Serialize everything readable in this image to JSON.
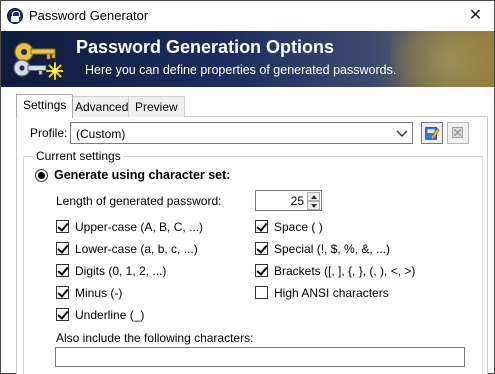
{
  "window": {
    "title": "Password Generator",
    "close_glyph": "✕"
  },
  "banner": {
    "title": "Password Generation Options",
    "subtitle": "Here you can define properties of generated passwords."
  },
  "tabs": [
    {
      "label": "Settings",
      "active": true
    },
    {
      "label": "Advanced",
      "active": false
    },
    {
      "label": "Preview",
      "active": false
    }
  ],
  "profile": {
    "label": "Profile:",
    "value": "(Custom)"
  },
  "group": {
    "title": "Current settings",
    "radio_label": "Generate using character set:",
    "length_label": "Length of generated password:",
    "length_value": "25"
  },
  "checkboxes": [
    {
      "label": "Upper-case (A, B, C, ...)",
      "checked": true
    },
    {
      "label": "Lower-case (a, b, c, ...)",
      "checked": true
    },
    {
      "label": "Digits (0, 1, 2, ...)",
      "checked": true
    },
    {
      "label": "Minus (-)",
      "checked": true
    },
    {
      "label": "Underline (_)",
      "checked": true
    },
    {
      "label": "Space ( )",
      "checked": true
    },
    {
      "label": "Special (!, $, %, &, ...)",
      "checked": true
    },
    {
      "label": "Brackets ([, ], {, }, (, ), <, >)",
      "checked": true
    },
    {
      "label": "High ANSI characters",
      "checked": false
    }
  ],
  "also_include": {
    "label": "Also include the following characters:",
    "value": ""
  },
  "colors": {
    "banner_dark": "#0f1c3d",
    "banner_mid": "#1a2d5e",
    "accent_gold": "#f5d25a"
  },
  "icons": {
    "app": "lock-icon",
    "banner": "keys-icon",
    "save_profile": "save-profile-icon",
    "delete_profile": "delete-icon",
    "dropdown": "chevron-down-icon"
  }
}
